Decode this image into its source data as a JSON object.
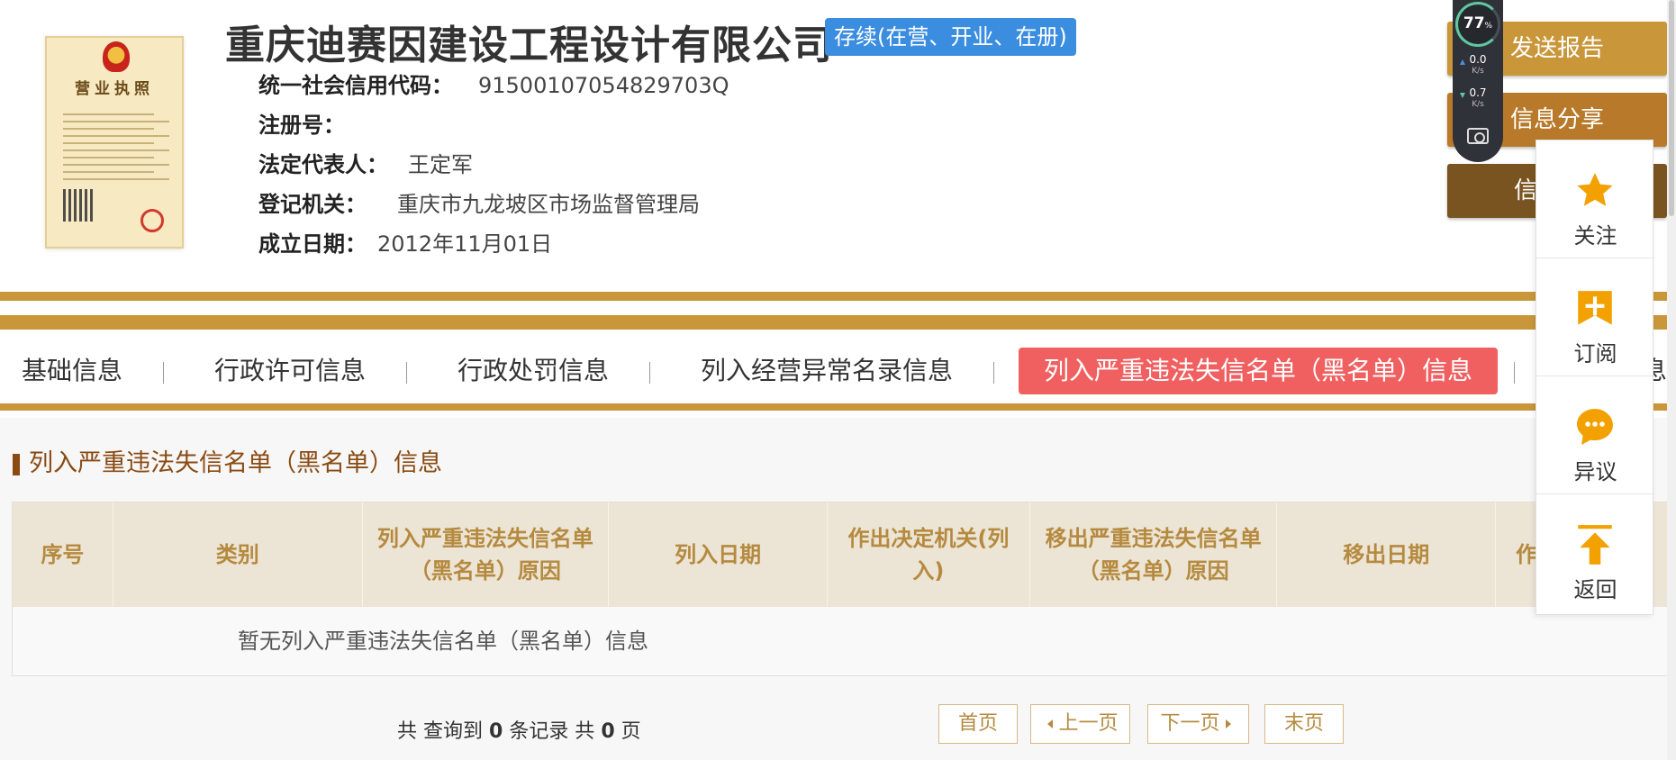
{
  "company": {
    "name": "重庆迪赛因建设工程设计有限公司",
    "status": "存续(在营、开业、在册)",
    "license_title": "营业执照"
  },
  "info": [
    {
      "label": "统一社会信用代码：",
      "value": "91500107054829703Q"
    },
    {
      "label": "注册号：",
      "value": ""
    },
    {
      "label": "法定代表人：",
      "value": "王定军"
    },
    {
      "label": "登记机关：",
      "value": "重庆市九龙坡区市场监督管理局"
    },
    {
      "label": "成立日期：",
      "value": "2012年11月01日"
    }
  ],
  "actions": [
    {
      "label": "发送报告"
    },
    {
      "label": "信息分享"
    },
    {
      "label": "信"
    }
  ],
  "tabs": [
    {
      "label": "基础信息"
    },
    {
      "label": "行政许可信息"
    },
    {
      "label": "行政处罚信息"
    },
    {
      "label": "列入经营异常名录信息"
    },
    {
      "label": "列入严重违法失信名单（黑名单）信息"
    },
    {
      "label": "息"
    }
  ],
  "section": {
    "title": "列入严重违法失信名单（黑名单）信息"
  },
  "table": {
    "headers": [
      "序号",
      "类别",
      "列入严重违法失信名单（黑名单）原因",
      "列入日期",
      "作出决定机关(列入)",
      "移出严重违法失信名单（黑名单）原因",
      "移出日期",
      "作"
    ],
    "empty_text": "暂无列入严重违法失信名单（黑名单）信息"
  },
  "pager": {
    "prefix": "共 查询到",
    "records": "0",
    "middle": "条记录 共",
    "pages": "0",
    "suffix": "页",
    "first": "首页",
    "prev": "上一页",
    "next": "下一页",
    "last": "末页"
  },
  "side_panel": [
    {
      "label": "关注",
      "icon": "star-icon"
    },
    {
      "label": "订阅",
      "icon": "subscribe-plus-icon"
    },
    {
      "label": "异议",
      "icon": "chat-bubble-icon"
    },
    {
      "label": "返回",
      "icon": "back-to-top-icon"
    }
  ],
  "net_monitor": {
    "percent": "77",
    "percent_unit": "%",
    "up": "0.0",
    "down": "0.7",
    "unit": "K/s"
  },
  "colors": {
    "gold": "#c9963a",
    "active_tab": "#f06060",
    "status_blue": "#3b8de0",
    "section_brown": "#8a4a12",
    "side_icon_orange": "#f2a100"
  }
}
